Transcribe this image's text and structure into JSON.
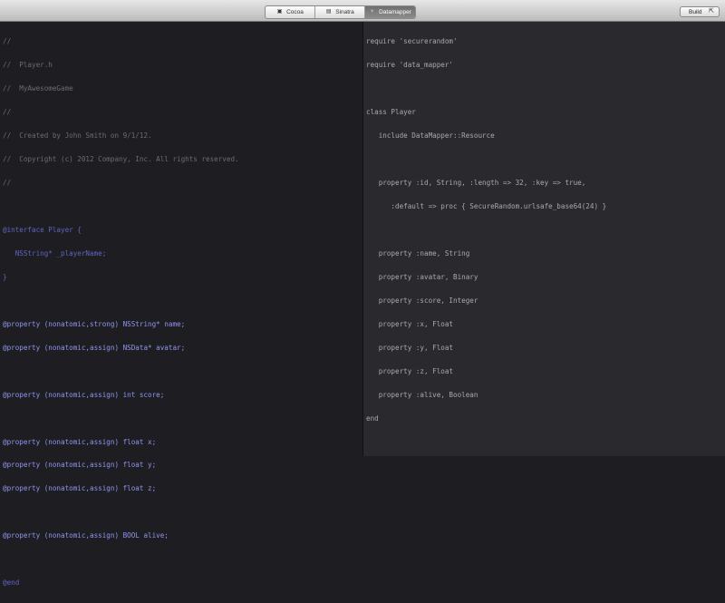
{
  "toolbar": {
    "tabs": [
      {
        "label": "Cocoa",
        "icon": "project-icon",
        "active": false
      },
      {
        "label": "Sinatra",
        "icon": "project-icon",
        "active": false
      },
      {
        "label": "Datamapper",
        "icon": "project-icon",
        "active": true
      }
    ],
    "build_label": "Build",
    "build_icon": "export-icon"
  },
  "left_editor": {
    "language": "objective-c",
    "lines": [
      "//",
      "//  Player.h",
      "//  MyAwesomeGame",
      "//",
      "//  Created by John Smith on 9/1/12.",
      "//  Copyright (c) 2012 Company, Inc. All rights reserved.",
      "//",
      "",
      "@interface Player {",
      "   NSString* _playerName;",
      "}",
      "",
      "@property (nonatomic,strong) NSString* name;",
      "@property (nonatomic,assign) NSData* avatar;",
      "",
      "@property (nonatomic,assign) int score;",
      "",
      "@property (nonatomic,assign) float x;",
      "@property (nonatomic,assign) float y;",
      "@property (nonatomic,assign) float z;",
      "",
      "@property (nonatomic,assign) BOOL alive;",
      "",
      "@end"
    ]
  },
  "right_editor": {
    "language": "ruby",
    "lines": [
      "require 'securerandom'",
      "require 'data_mapper'",
      "",
      "class Player",
      "   include DataMapper::Resource",
      "",
      "   property :id, String, :length => 32, :key => true,",
      "      :default => proc { SecureRandom.urlsafe_base64(24) }",
      "",
      "   property :name, String",
      "   property :avatar, Binary",
      "   property :score, Integer",
      "   property :x, Float",
      "   property :y, Float",
      "   property :z, Float",
      "   property :alive, Boolean",
      "end"
    ]
  },
  "colors": {
    "comment": "#6b6b70",
    "keyword": "#7f86e0",
    "property": "#8f95ee",
    "ruby_text": "#a9a9ad",
    "left_bg": "#1e1e22",
    "right_bg": "#2a2a2e"
  }
}
